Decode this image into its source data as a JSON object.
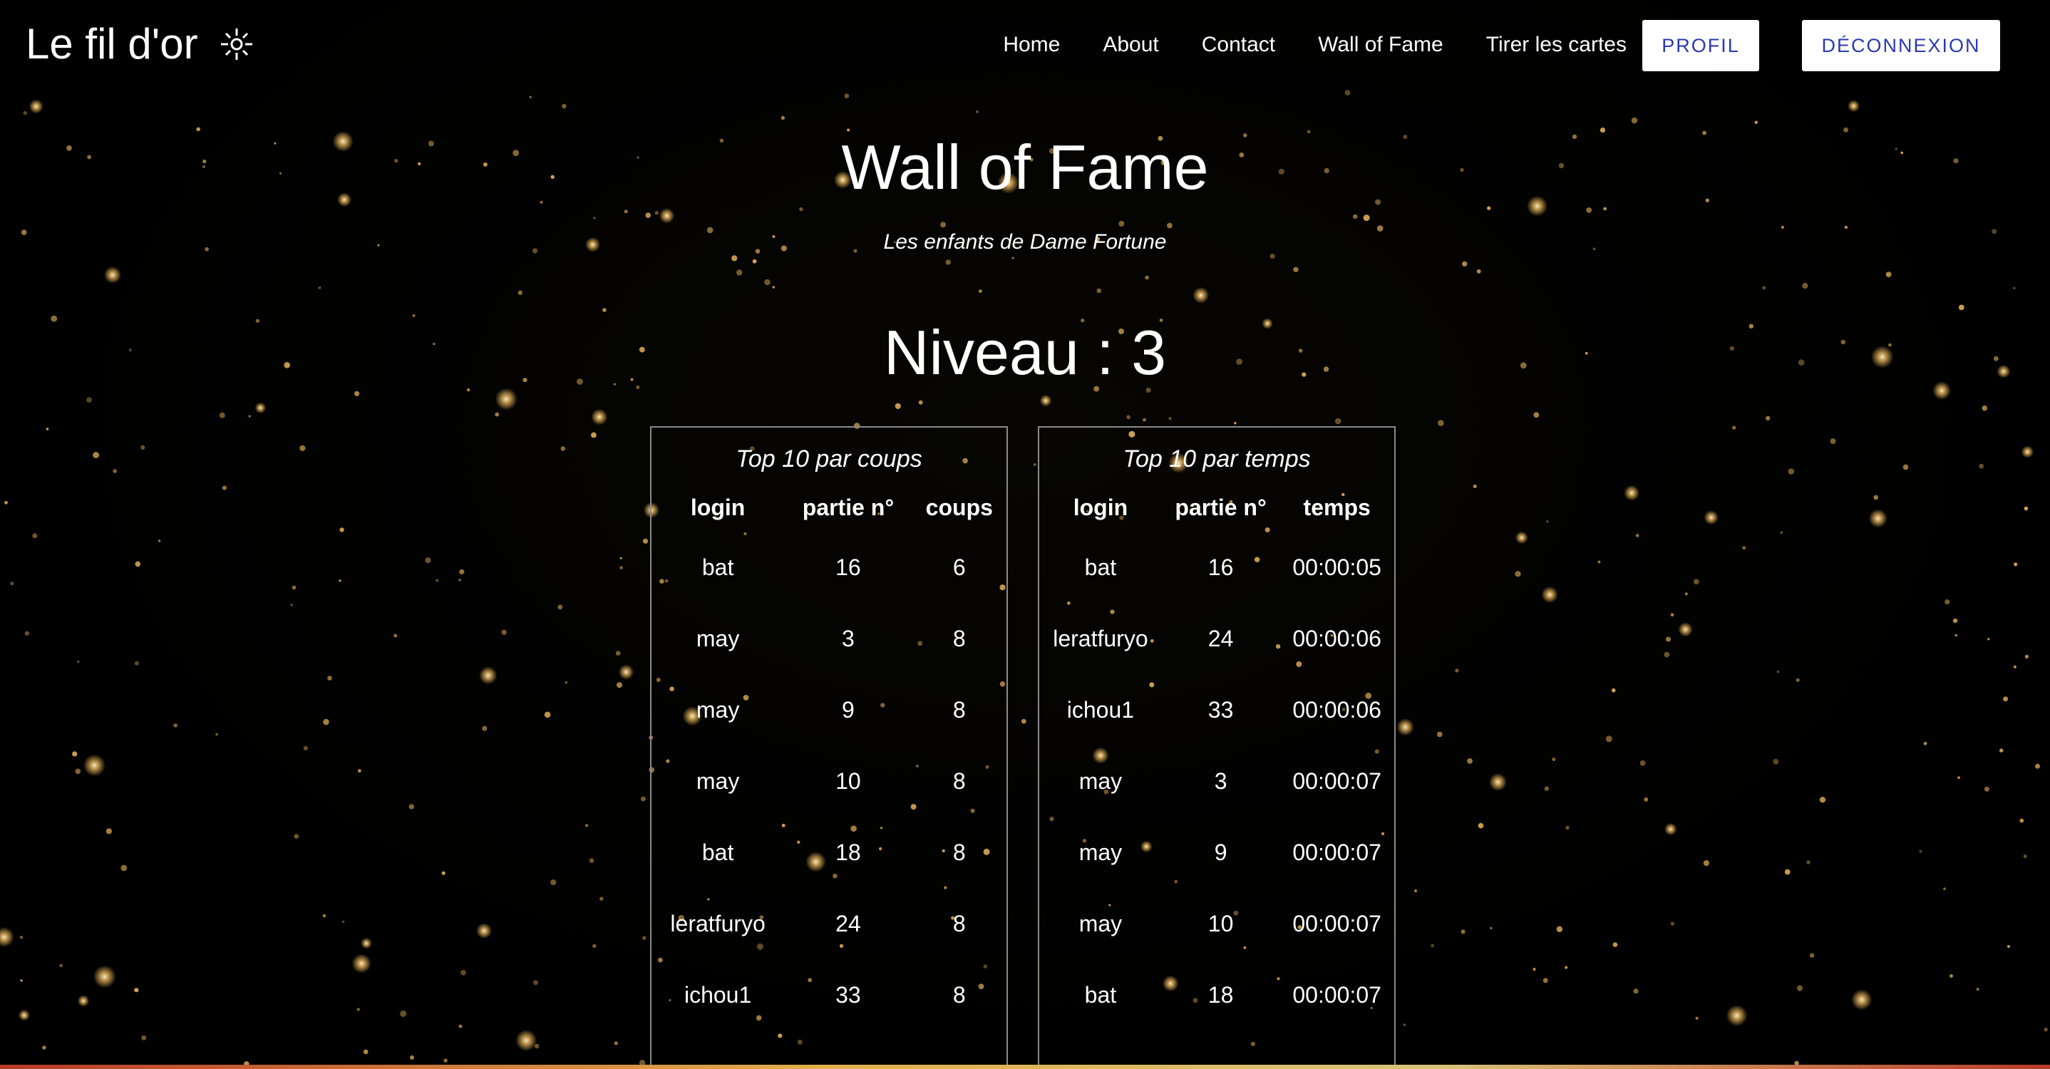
{
  "navbar": {
    "brand": "Le fil d'or",
    "brand_icon": "sparkle-icon",
    "links": [
      "Home",
      "About",
      "Contact",
      "Wall of Fame",
      "Tirer les cartes"
    ],
    "profil_label": "PROFIL",
    "logout_label": "DÉCONNEXION"
  },
  "page": {
    "title": "Wall of Fame",
    "subtitle": "Les enfants de Dame Fortune",
    "level": "Niveau : 3"
  },
  "tables": {
    "coups": {
      "caption": "Top 10 par coups",
      "headers": [
        "login",
        "partie n°",
        "coups"
      ],
      "rows": [
        [
          "bat",
          "16",
          "6"
        ],
        [
          "may",
          "3",
          "8"
        ],
        [
          "may",
          "9",
          "8"
        ],
        [
          "may",
          "10",
          "8"
        ],
        [
          "bat",
          "18",
          "8"
        ],
        [
          "leratfuryo",
          "24",
          "8"
        ],
        [
          "ichou1",
          "33",
          "8"
        ]
      ]
    },
    "temps": {
      "caption": "Top 10 par temps",
      "headers": [
        "login",
        "partie n°",
        "temps"
      ],
      "rows": [
        [
          "bat",
          "16",
          "00:00:05"
        ],
        [
          "leratfuryo",
          "24",
          "00:00:06"
        ],
        [
          "ichou1",
          "33",
          "00:00:06"
        ],
        [
          "may",
          "3",
          "00:00:07"
        ],
        [
          "may",
          "9",
          "00:00:07"
        ],
        [
          "may",
          "10",
          "00:00:07"
        ],
        [
          "bat",
          "18",
          "00:00:07"
        ]
      ]
    }
  },
  "colors": {
    "background": "#000000",
    "text": "#ffffff",
    "button_text": "#2a3ab0",
    "star": "#f5c060",
    "panel_border": "#8a8a8a"
  }
}
